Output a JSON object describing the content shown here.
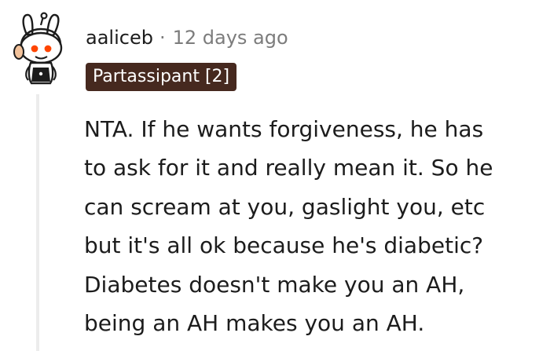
{
  "comment": {
    "username": "aaliceb",
    "separator": "·",
    "timestamp": "12 days ago",
    "flair": {
      "label": "Partassipant [2]",
      "background": "#46291f"
    },
    "avatar_icon": "snoo-bunny-avatar-icon",
    "body_lines": [
      "NTA. If he wants forgiveness, he has",
      "to ask for it and really mean it. So he",
      "can scream at you, gaslight you, etc",
      "but it's all ok because he's diabetic?",
      "Diabetes doesn't make you an AH,",
      "being an AH makes you an AH."
    ]
  }
}
